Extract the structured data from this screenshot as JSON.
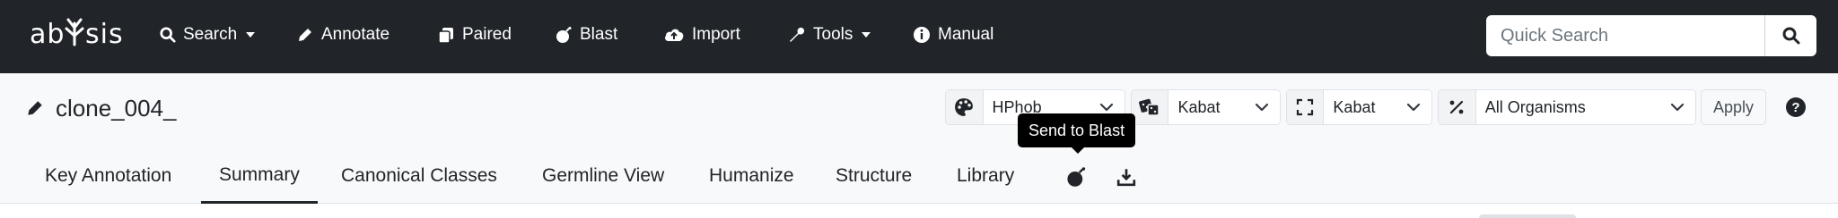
{
  "brand": {
    "name": "abysis"
  },
  "nav": {
    "items": [
      {
        "label": "Search",
        "icon": "search-icon",
        "dropdown": true
      },
      {
        "label": "Annotate",
        "icon": "pencil-icon",
        "dropdown": false
      },
      {
        "label": "Paired",
        "icon": "copy-icon",
        "dropdown": false
      },
      {
        "label": "Blast",
        "icon": "bomb-icon",
        "dropdown": false
      },
      {
        "label": "Import",
        "icon": "cloud-upload-icon",
        "dropdown": false
      },
      {
        "label": "Tools",
        "icon": "wrench-icon",
        "dropdown": true
      },
      {
        "label": "Manual",
        "icon": "info-circle-icon",
        "dropdown": false
      }
    ],
    "quick_search": {
      "placeholder": "Quick Search",
      "value": ""
    }
  },
  "header": {
    "title": "clone_004_",
    "controls": {
      "color_scheme": {
        "icon": "palette-icon",
        "value": "HPhob"
      },
      "numbering": {
        "icon": "dice-icon",
        "value": "Kabat"
      },
      "cdr_definition": {
        "icon": "expand-icon",
        "value": "Kabat"
      },
      "organism": {
        "icon": "percent-icon",
        "value": "All Organisms"
      }
    },
    "apply_label": "Apply",
    "help_label": "?"
  },
  "tabs": [
    {
      "label": "Key Annotation",
      "active": false
    },
    {
      "label": "Summary",
      "active": true
    },
    {
      "label": "Canonical Classes",
      "active": false
    },
    {
      "label": "Germline View",
      "active": false
    },
    {
      "label": "Humanize",
      "active": false
    },
    {
      "label": "Structure",
      "active": false
    },
    {
      "label": "Library",
      "active": false
    }
  ],
  "tab_actions": [
    {
      "icon": "bomb-icon",
      "tooltip": "Send to Blast"
    },
    {
      "icon": "download-icon"
    }
  ],
  "tooltip": {
    "text": "Send to Blast"
  },
  "colors": {
    "navbar_bg": "#212529",
    "header_bg": "#f8f9fa",
    "tooltip_bg": "#000000"
  }
}
